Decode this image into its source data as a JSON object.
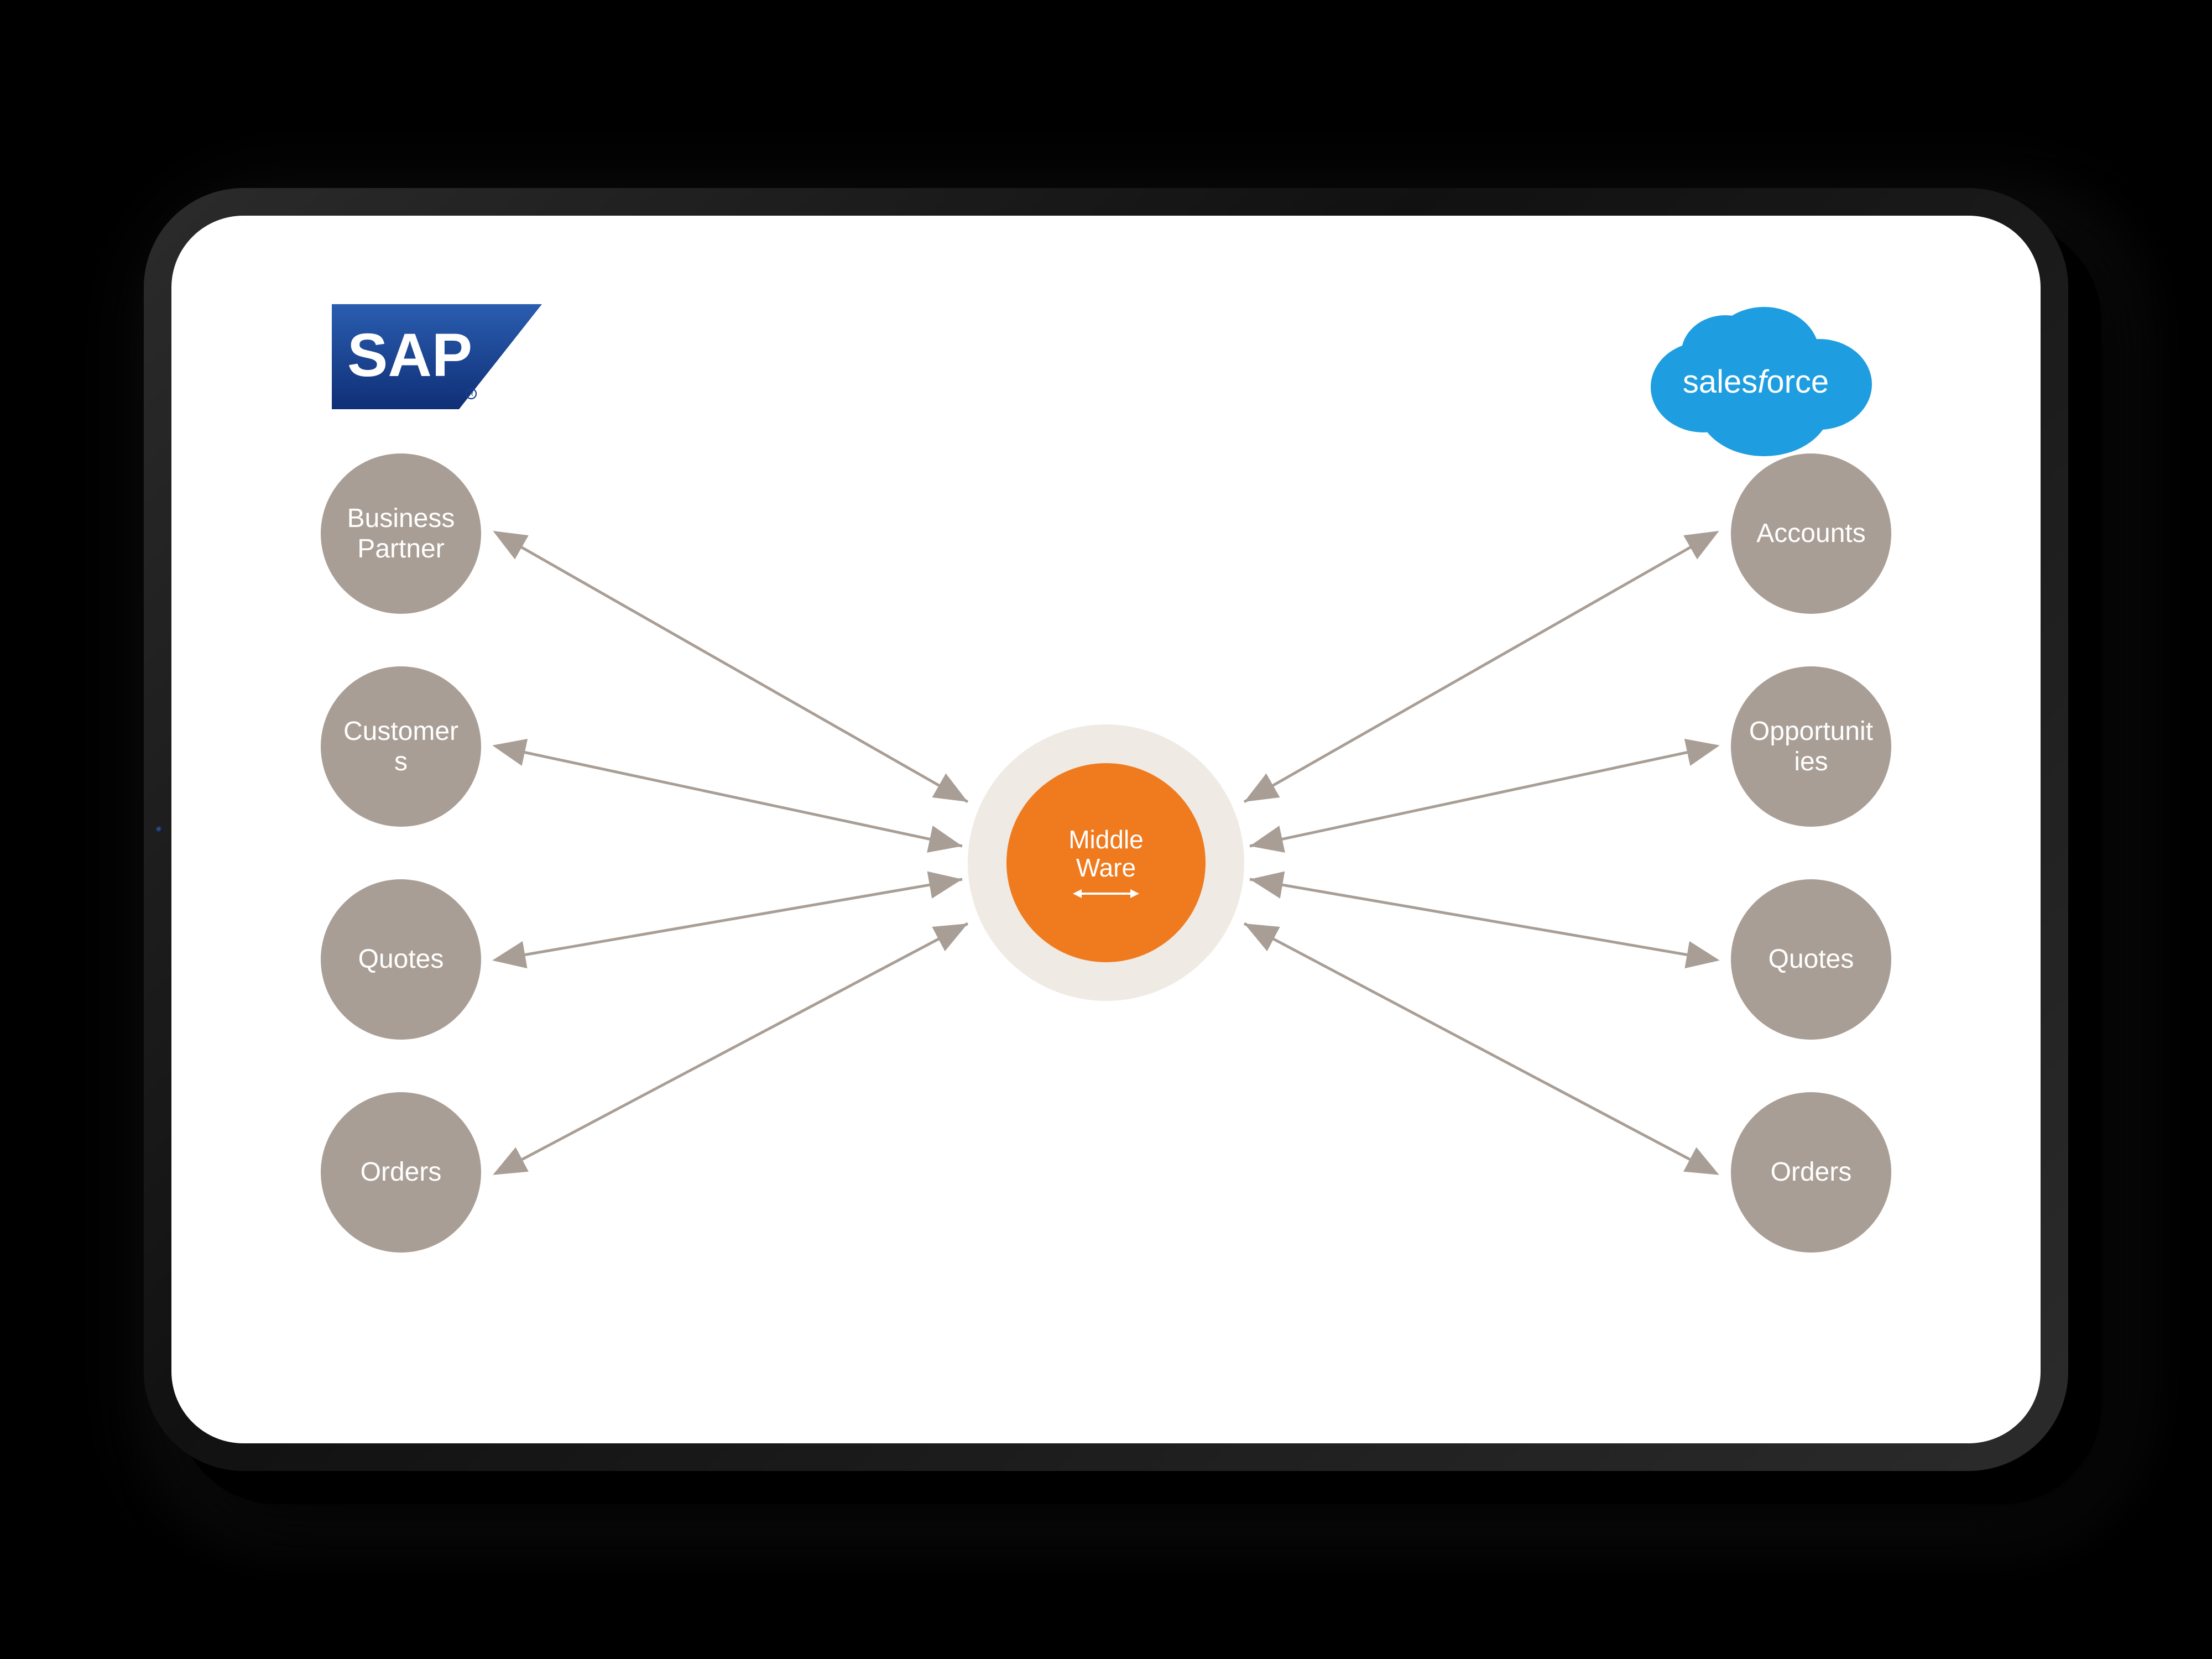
{
  "logos": {
    "left": "SAP",
    "right": "salesforce"
  },
  "left_column": [
    {
      "label": "Business Partner"
    },
    {
      "label": "Customers"
    },
    {
      "label": "Quotes"
    },
    {
      "label": "Orders"
    }
  ],
  "right_column": [
    {
      "label": "Accounts"
    },
    {
      "label": "Opportunities"
    },
    {
      "label": "Quotes"
    },
    {
      "label": "Orders"
    }
  ],
  "center": {
    "line1": "Middle",
    "line2": "Ware"
  },
  "colors": {
    "node_fill": "#a99e95",
    "middleware_ring": "#efeae4",
    "middleware_core": "#f07a1e",
    "sap_blue": "#1a3e8f",
    "salesforce_blue": "#1e9ee0",
    "connector": "#a99e95"
  }
}
